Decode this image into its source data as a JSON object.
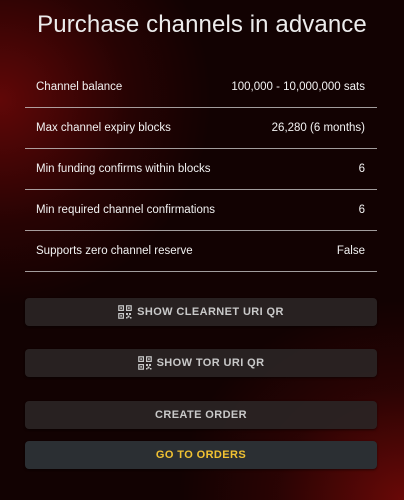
{
  "page": {
    "title": "Purchase channels in advance"
  },
  "details": [
    {
      "label": "Channel balance",
      "value": "100,000 - 10,000,000 sats"
    },
    {
      "label": "Max channel expiry blocks",
      "value": "26,280 (6 months)"
    },
    {
      "label": "Min funding confirms within blocks",
      "value": "6"
    },
    {
      "label": "Min required channel confirmations",
      "value": "6"
    },
    {
      "label": "Supports zero channel reserve",
      "value": "False"
    }
  ],
  "buttons": {
    "clearnet_qr": "SHOW CLEARNET URI QR",
    "tor_qr": "SHOW TOR URI QR",
    "create_order": "CREATE ORDER",
    "go_to_orders": "GO TO ORDERS"
  },
  "icons": {
    "qr": "qr-code-icon"
  },
  "colors": {
    "accent": "#f1c232",
    "button_text": "#c9c9c9"
  }
}
